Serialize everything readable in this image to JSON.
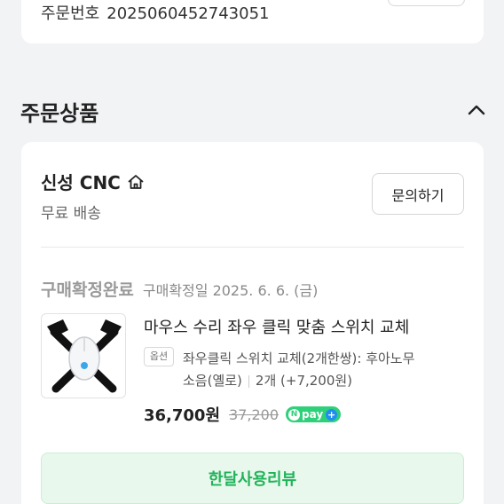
{
  "order": {
    "number_label": "주문번호",
    "number": "2025060452743051"
  },
  "section": {
    "title": "주문상품"
  },
  "store": {
    "name": "신성 CNC",
    "shipping": "무료 배송",
    "inquiry_label": "문의하기"
  },
  "purchase": {
    "status": "구매확정완료",
    "confirm_date": "구매확정일 2025. 6. 6. (금)"
  },
  "product": {
    "title": "마우스 수리 좌우 클릭 맞춤 스위치 교체",
    "option_badge": "옵션",
    "option_line1": "좌우클릭 스위치 교체(2개한쌍): 후아노무",
    "option_line2": "소음(옐로)",
    "quantity": "2개 (+7,200원)",
    "price": "36,700원",
    "original_price": "37,200",
    "npay_label": "pay"
  },
  "review": {
    "label": "한달사용리뷰"
  },
  "icons": {
    "store_icon": "home-icon",
    "collapse_icon": "chevron-up-icon"
  },
  "colors": {
    "accent_green": "#20b35a",
    "review_bg": "#e9f8ed",
    "npay_green": "#2fd07a"
  }
}
